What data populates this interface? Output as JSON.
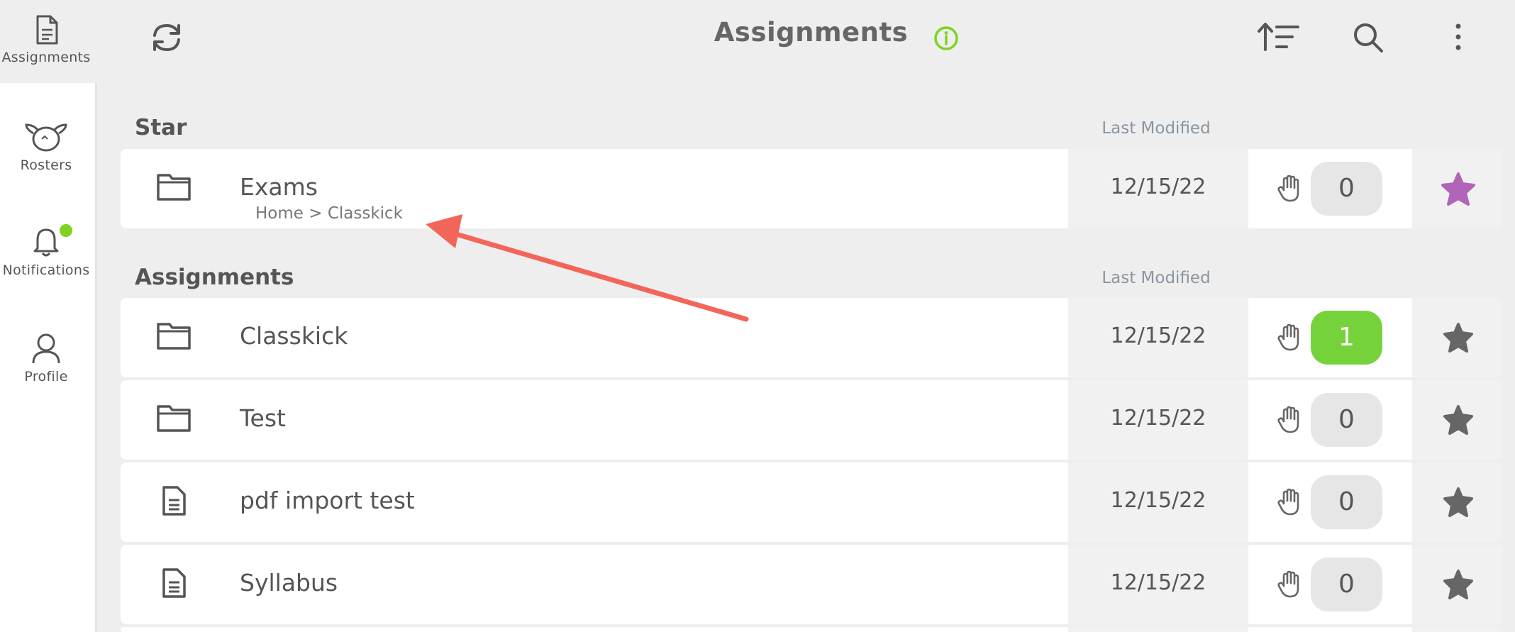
{
  "sidebar": {
    "items": [
      {
        "label": "Assignments",
        "icon": "document-icon"
      },
      {
        "label": "Rosters",
        "icon": "sheep-icon"
      },
      {
        "label": "Notifications",
        "icon": "bell-icon"
      },
      {
        "label": "Profile",
        "icon": "person-icon"
      }
    ]
  },
  "header": {
    "title": "Assignments",
    "icons": [
      "refresh-icon",
      "info-icon",
      "sort-icon",
      "search-icon",
      "more-icon"
    ]
  },
  "sections": {
    "star": {
      "title": "Star",
      "last_modified_label": "Last Modified",
      "rows": [
        {
          "name": "Exams",
          "breadcrumb": "Home > Classkick",
          "date": "12/15/22",
          "count": "0",
          "type": "folder",
          "starred": true
        }
      ]
    },
    "assignments": {
      "title": "Assignments",
      "last_modified_label": "Last Modified",
      "rows": [
        {
          "name": "Classkick",
          "date": "12/15/22",
          "count": "1",
          "type": "folder",
          "starred": false
        },
        {
          "name": "Test",
          "date": "12/15/22",
          "count": "0",
          "type": "folder",
          "starred": false
        },
        {
          "name": "pdf import test",
          "date": "12/15/22",
          "count": "0",
          "type": "document",
          "starred": false
        },
        {
          "name": "Syllabus",
          "date": "12/15/22",
          "count": "0",
          "type": "document",
          "starred": false
        }
      ]
    }
  },
  "colors": {
    "accent_green": "#7ed321",
    "badge_green": "#76d23a",
    "star_active": "#b065b8",
    "star_inactive": "#666666",
    "annotation_arrow": "#f2665a"
  }
}
